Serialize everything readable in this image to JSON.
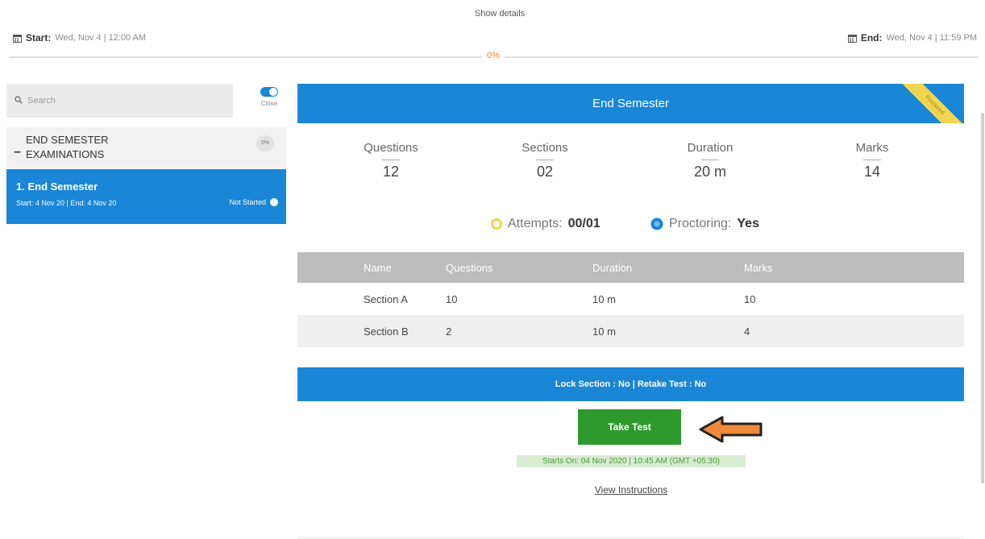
{
  "header": {
    "show_details": "Show details",
    "start_label": "Start:",
    "start_value": "Wed, Nov 4 | 12:00 AM",
    "end_label": "End:",
    "end_value": "Wed, Nov 4 | 11:59 PM",
    "progress": "0%",
    "progress_value": 0
  },
  "sidebar": {
    "search_placeholder": "Search",
    "toggle_label": "Close",
    "toggle_on": true,
    "group_title": "END SEMESTER EXAMINATIONS",
    "group_badge": "0%",
    "item": {
      "title": "1. End Semester",
      "dates": "Start: 4 Nov 20 | End: 4 Nov 20",
      "status": "Not Started"
    }
  },
  "main": {
    "banner_title": "End Semester",
    "ribbon": "Proctored",
    "stats": {
      "questions_label": "Questions",
      "questions_value": "12",
      "sections_label": "Sections",
      "sections_value": "02",
      "duration_label": "Duration",
      "duration_value": "20 m",
      "marks_label": "Marks",
      "marks_value": "14"
    },
    "attempts_label": "Attempts:",
    "attempts_value": "00/01",
    "proctoring_label": "Proctoring:",
    "proctoring_value": "Yes",
    "table": {
      "headers": [
        "Name",
        "Questions",
        "Duration",
        "Marks"
      ],
      "rows": [
        [
          "Section A",
          "10",
          "10 m",
          "10"
        ],
        [
          "Section B",
          "2",
          "10 m",
          "4"
        ]
      ]
    },
    "lock_bar": "Lock Section : No | Retake Test : No",
    "take_test": "Take Test",
    "starts_on": "Starts On: 04 Nov 2020 | 10:45 AM (GMT +05:30)",
    "view_instructions": "View Instructions"
  },
  "colors": {
    "primary": "#1a86d6",
    "success": "#2e9a2e",
    "arrow": "#f08a3a",
    "accent_yellow": "#f2d54e"
  }
}
